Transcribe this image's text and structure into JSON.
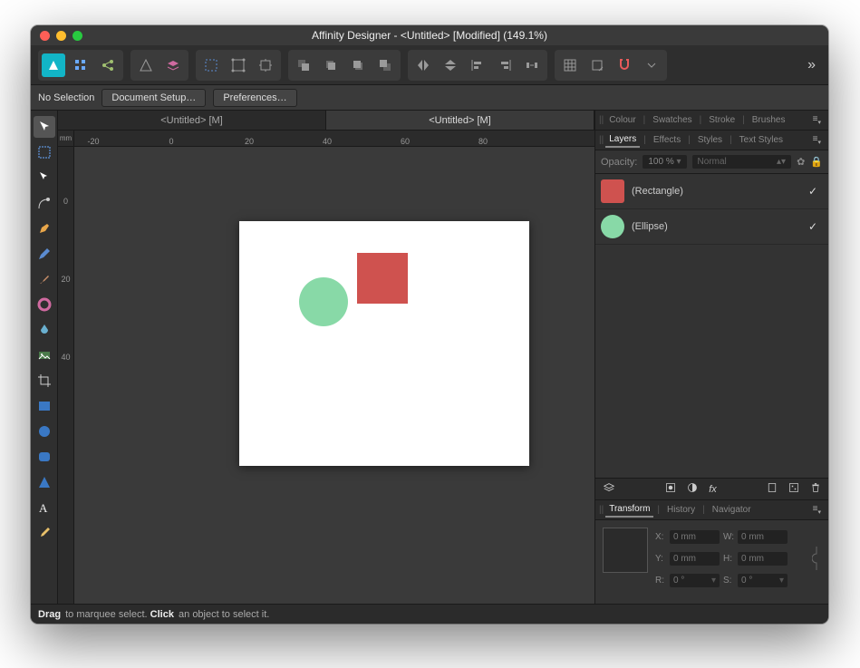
{
  "window": {
    "title": "Affinity Designer - <Untitled> [Modified] (149.1%)"
  },
  "context": {
    "selection_label": "No Selection",
    "doc_setup": "Document Setup…",
    "preferences": "Preferences…"
  },
  "doc_tabs": [
    "<Untitled> [M]",
    "<Untitled> [M]"
  ],
  "ruler": {
    "unit": "mm",
    "h": [
      "-20",
      "0",
      "20",
      "40",
      "60",
      "80"
    ],
    "v": [
      "0",
      "20",
      "40"
    ]
  },
  "panels": {
    "row1": [
      "Colour",
      "Swatches",
      "Stroke",
      "Brushes"
    ],
    "row2": [
      "Layers",
      "Effects",
      "Styles",
      "Text Styles"
    ],
    "opacity_label": "Opacity:",
    "opacity_value": "100 %",
    "blend_mode": "Normal",
    "layers": [
      {
        "name": "(Rectangle)",
        "color": "#cf524f",
        "visible": true,
        "shape": "rect"
      },
      {
        "name": "(Ellipse)",
        "color": "#88d9a7",
        "visible": true,
        "shape": "ellipse"
      }
    ],
    "transform_tabs": [
      "Transform",
      "History",
      "Navigator"
    ],
    "transform": {
      "X": "0 mm",
      "Y": "0 mm",
      "W": "0 mm",
      "H": "0 mm",
      "R": "0 °",
      "S": "0 °"
    }
  },
  "status": {
    "line": [
      "Drag",
      " to marquee select. ",
      "Click",
      " an object to select it."
    ]
  },
  "icons": {
    "gear": "gear-icon",
    "lock": "lock-icon",
    "menu": "menu-icon"
  }
}
